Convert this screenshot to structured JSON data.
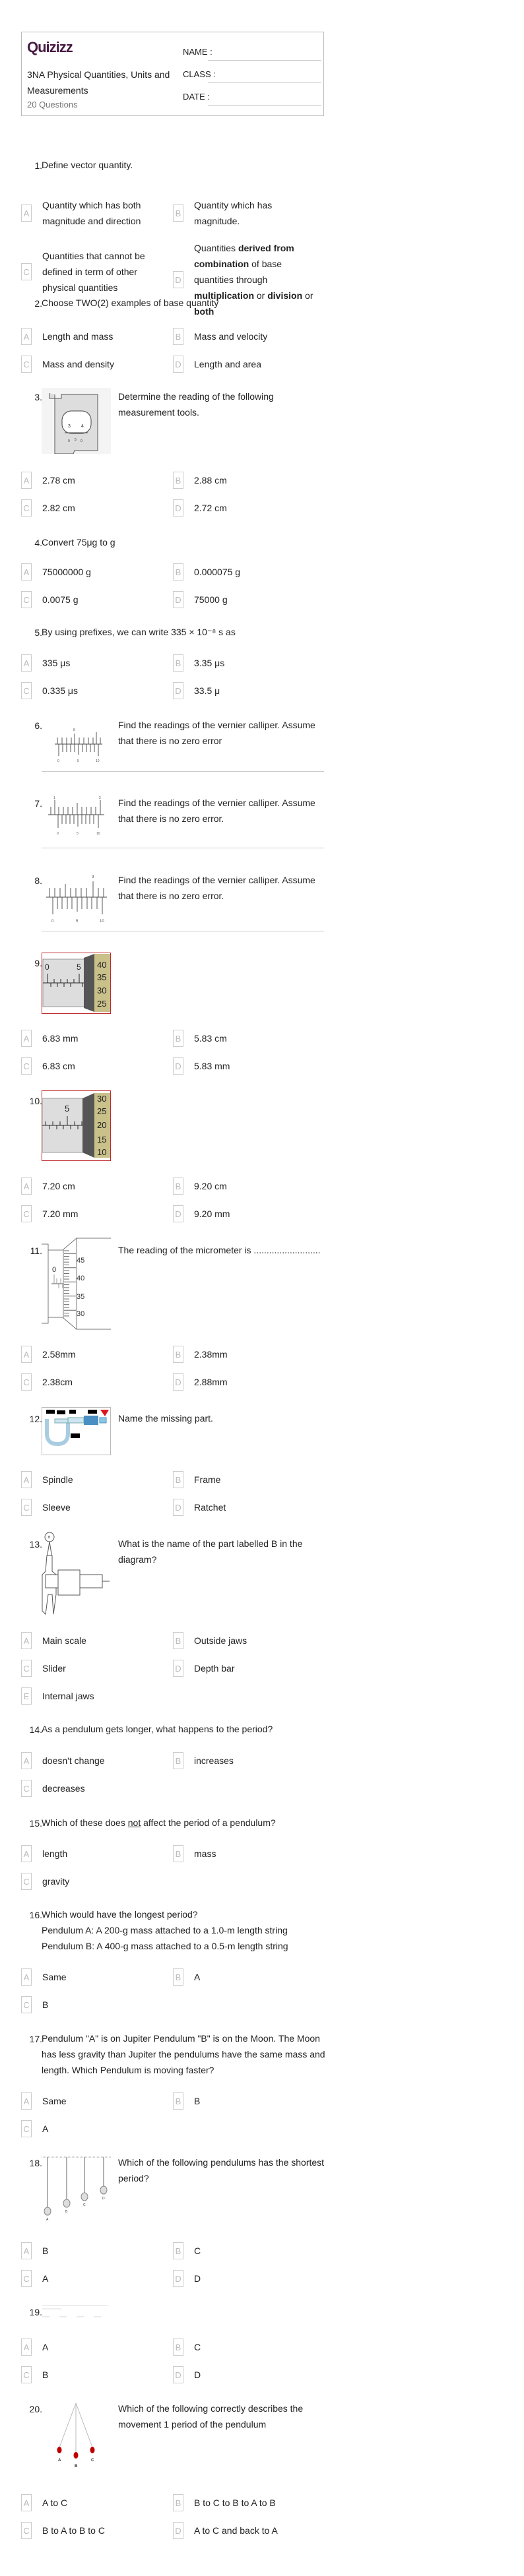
{
  "header": {
    "logo": "Quizizz",
    "title": "3NA Physical Quantities, Units and Measurements",
    "count": "20 Questions",
    "name_label": "NAME :",
    "class_label": "CLASS :",
    "date_label": "DATE :"
  },
  "questions": [
    {
      "num": "1.",
      "text": "Define vector quantity.",
      "options": [
        "Quantity which has both magnitude and direction",
        "Quantity which has magnitude.",
        "Quantities that cannot be defined in term of other physical quantities",
        "Quantities derived from combination of base quantities through multiplication or division or both"
      ]
    },
    {
      "num": "2.",
      "text": "Choose TWO(2) examples of base quantity",
      "options": [
        "Length and mass",
        "Mass and velocity",
        "Mass and density",
        "Length and area"
      ]
    },
    {
      "num": "3.",
      "text": "Determine the reading of the following measurement tools.",
      "options": [
        "2.78 cm",
        "2.88 cm",
        "2.82 cm",
        "2.72 cm"
      ]
    },
    {
      "num": "4.",
      "text": "Convert 75μg to g",
      "options": [
        "75000000 g",
        "0.000075 g",
        "0.0075 g",
        "75000 g"
      ]
    },
    {
      "num": "5.",
      "text": "By using prefixes, we can write 335 × 10⁻⁸ s as",
      "options": [
        "335 μs",
        "3.35 μs",
        "0.335 μs",
        "33.5 μ"
      ]
    },
    {
      "num": "6.",
      "text": "Find the readings of the vernier calliper. Assume that there is no zero error"
    },
    {
      "num": "7.",
      "text": "Find the readings of the vernier calliper. Assume that there is no zero error."
    },
    {
      "num": "8.",
      "text": "Find the readings of the vernier calliper. Assume that there is no zero error."
    },
    {
      "num": "9.",
      "options": [
        "6.83 mm",
        "5.83 cm",
        "6.83 cm",
        "5.83 mm"
      ]
    },
    {
      "num": "10.",
      "options": [
        "7.20 cm",
        "9.20 cm",
        "7.20 mm",
        "9.20 mm"
      ]
    },
    {
      "num": "11.",
      "text": "The reading of the micrometer is ..........................",
      "options": [
        "2.58mm",
        "2.38mm",
        "2.38cm",
        "2.88mm"
      ]
    },
    {
      "num": "12.",
      "text": "Name the missing part.",
      "options": [
        "Spindle",
        "Frame",
        "Sleeve",
        "Ratchet"
      ]
    },
    {
      "num": "13.",
      "text": "What is the name of the part labelled B in the diagram?",
      "options": [
        "Main scale",
        "Outside jaws",
        "Slider",
        "Depth bar",
        "Internal jaws"
      ]
    },
    {
      "num": "14.",
      "text": "As a pendulum gets longer, what happens to the period?",
      "options": [
        "doesn't change",
        "increases",
        "decreases"
      ]
    },
    {
      "num": "15.",
      "text_pre": "Which of these does ",
      "text_u": "not",
      "text_post": " affect the period of a pendulum?",
      "options": [
        "length",
        "mass",
        "gravity"
      ]
    },
    {
      "num": "16.",
      "text": "Which would have the longest period?",
      "line2": "Pendulum A: A 200-g mass attached to a 1.0-m length string",
      "line3": "Pendulum B: A 400-g mass attached to a 0.5-m length string",
      "options": [
        "Same",
        "A",
        "B"
      ]
    },
    {
      "num": "17.",
      "text": "Pendulum \"A\" is on Jupiter Pendulum \"B\" is on the Moon.  The Moon has less gravity than  Jupiter the pendulums have the same mass and length.  Which Pendulum is moving faster?",
      "options": [
        "Same",
        "B",
        "A"
      ]
    },
    {
      "num": "18.",
      "text": "Which of the following pendulums has the shortest period?",
      "options": [
        "B",
        "C",
        "A",
        "D"
      ]
    },
    {
      "num": "19.",
      "options": [
        "A",
        "C",
        "B",
        "D"
      ]
    },
    {
      "num": "20.",
      "text": "Which of the following correctly describes the movement 1 period of the pendulum",
      "options": [
        "A to C",
        "B to C to B to A to B",
        "B to A to B to C",
        "A to C and back to A"
      ]
    }
  ],
  "letters": [
    "A",
    "B",
    "C",
    "D",
    "E"
  ],
  "diagram_labels": {
    "q3": [
      "3",
      "4",
      "0",
      "5",
      "0"
    ],
    "q6": [
      "8",
      "0",
      "5",
      "10"
    ],
    "q7": [
      "1",
      "2",
      "0",
      "5",
      "10"
    ],
    "q8": [
      "9",
      "0",
      "5",
      "10"
    ],
    "q9": [
      "0",
      "5",
      "40",
      "35",
      "30",
      "25"
    ],
    "q10": [
      "5",
      "30",
      "25",
      "20",
      "15",
      "10"
    ],
    "q11": [
      "0",
      "45",
      "40",
      "35",
      "30"
    ],
    "q13": [
      "B"
    ],
    "q18": [
      "A",
      "B",
      "C",
      "D"
    ],
    "q20": [
      "A",
      "B",
      "C"
    ]
  },
  "colors": {
    "brand": "#461a42",
    "pendulum_bob": "#c00000",
    "thimble": "#c9c08a"
  }
}
